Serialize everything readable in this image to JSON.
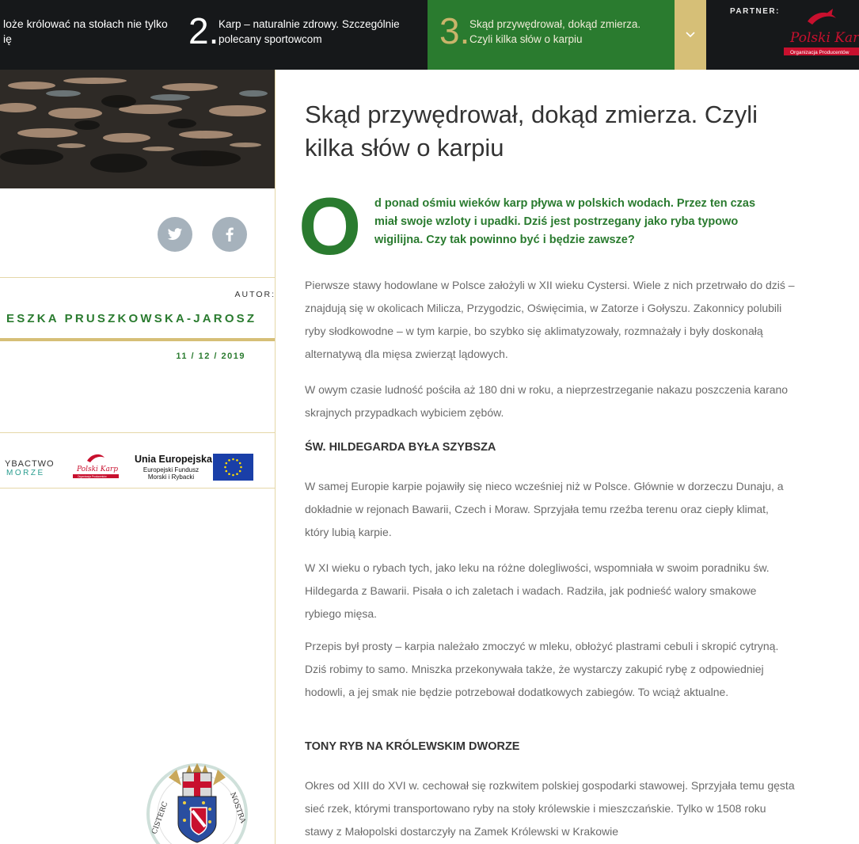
{
  "topbar": {
    "item1": {
      "line1": "loże królować na stołach nie tylko",
      "line2": "ię"
    },
    "item2": {
      "number": "2.",
      "line1": "Karp – naturalnie zdrowy. Szczególnie",
      "line2": "polecany sportowcom"
    },
    "item3": {
      "number": "3.",
      "line1": "Skąd przywędrował, dokąd zmierza.",
      "line2": "Czyli kilka słów o karpiu"
    },
    "partner_label": "PARTNER:",
    "partner_logo_text": "Polski Karp",
    "partner_logo_sub": "Organizacja Producentów",
    "icons": {
      "dropdown": "chevron-down-icon"
    },
    "colors": {
      "active": "#2a7b2f",
      "accent": "#d6bf77",
      "bar": "#16181a"
    }
  },
  "sidebar": {
    "social": [
      {
        "name": "twitter-icon"
      },
      {
        "name": "facebook-icon"
      }
    ],
    "author_label": "AUTOR:",
    "author_name": "ESZKA PRUSZKOWSKA-JAROSZ",
    "date": "11 / 12 / 2019",
    "sponsors": {
      "rybactwo_line1": "YBACTWO",
      "rybactwo_line2": "MORZE",
      "karp_logo_text": "Polski Karp",
      "karp_logo_sub": "Organizacja Producentów",
      "ue_title": "Unia Europejska",
      "ue_sub": "Europejski Fundusz Morski i Rybacki"
    },
    "crest_text_left": "CISTERC",
    "crest_text_right": "NOSTRA"
  },
  "article": {
    "title": "Skąd przywędrował, dokąd zmierza. Czyli kilka słów o karpiu",
    "dropcap": "O",
    "lead": "d ponad ośmiu wieków karp pływa w polskich wodach. Przez ten czas miał swoje wzloty i upadki. Dziś jest postrzegany jako ryba typowo wigilijna. Czy tak powinno być i będzie zawsze?",
    "p1": "Pierwsze stawy hodowlane w Polsce założyli w XII wieku Cystersi. Wiele z nich przetrwało do dziś – znajdują się w okolicach Milicza, Przygodzic, Oświęcimia, w Zatorze i Gołyszu. Zakonnicy polubili ryby słodkowodne – w tym karpie, bo szybko się aklimatyzowały, rozmnażały i były doskonałą alternatywą dla mięsa zwierząt lądowych.",
    "p2": "W owym czasie ludność pościła aż 180 dni w roku, a nieprzestrzeganie nakazu poszczenia karano skrajnych przypadkach wybiciem zębów.",
    "h1": "ŚW. HILDEGARDA BYŁA SZYBSZA",
    "p3": "W samej Europie karpie pojawiły się nieco wcześniej niż w Polsce. Głównie w dorzeczu Dunaju, a dokładnie w rejonach Bawarii, Czech i Moraw. Sprzyjała temu rzeźba terenu oraz ciepły klimat, który lubią karpie.",
    "p4": "W XI wieku o rybach tych, jako leku na różne dolegliwości, wspomniała w swoim poradniku św. Hildegarda z Bawarii. Pisała o ich zaletach i wadach. Radziła, jak podnieść walory smakowe rybiego mięsa.",
    "p5": "Przepis był prosty – karpia należało zmoczyć w mleku, obłożyć plastrami cebuli i skropić cytryną. Dziś robimy to samo. Mniszka przekonywała także, że wystarczy zakupić rybę z odpowiedniej hodowli, a jej smak nie będzie potrzebował dodatkowych zabiegów. To wciąż aktualne.",
    "h2": "TONY RYB NA KRÓLEWSKIM DWORZE",
    "p6": "Okres od XIII do XVI w. cechował się rozkwitem polskiej gospodarki stawowej. Sprzyjała temu gęsta sieć rzek, którymi transportowano ryby na stoły królewskie i mieszczańskie. Tylko w 1508 roku stawy z Małopolski dostarczyły na Zamek Królewski w Krakowie"
  }
}
